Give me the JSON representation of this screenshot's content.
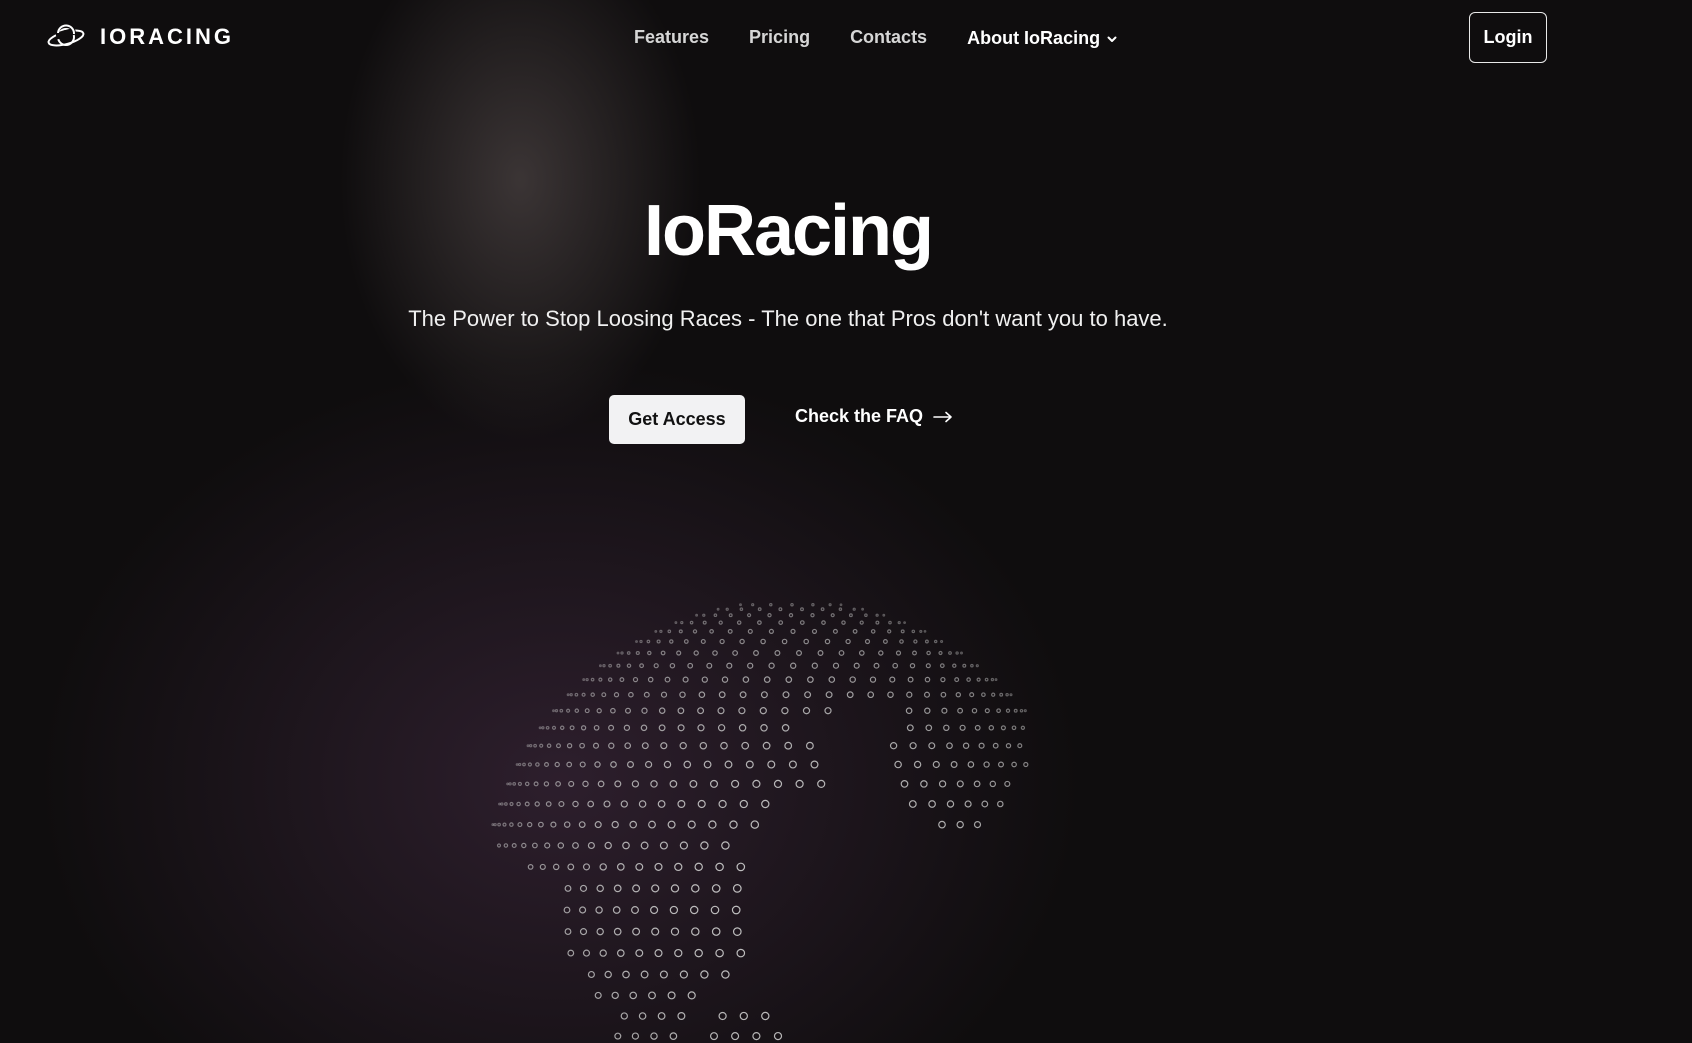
{
  "brand": {
    "name": "IORACING",
    "icon": "planet-icon"
  },
  "nav": {
    "links": [
      {
        "label": "Features"
      },
      {
        "label": "Pricing"
      },
      {
        "label": "Contacts"
      },
      {
        "label": "About IoRacing",
        "icon": "chevron-down-icon"
      }
    ],
    "login_label": "Login"
  },
  "hero": {
    "title": "IoRacing",
    "subtitle": "The Power to Stop Loosing Races - The one that Pros don't want you to have.",
    "primary_cta": "Get Access",
    "secondary_cta": "Check the FAQ",
    "secondary_icon": "arrow-right-icon"
  },
  "globe": {
    "icon": "dotted-globe-illustration"
  },
  "colors": {
    "background": "#0f0d0e",
    "primary_button_bg": "#f2f2f3",
    "glow_top": "#5f5555",
    "glow_bottom": "#462d46"
  }
}
